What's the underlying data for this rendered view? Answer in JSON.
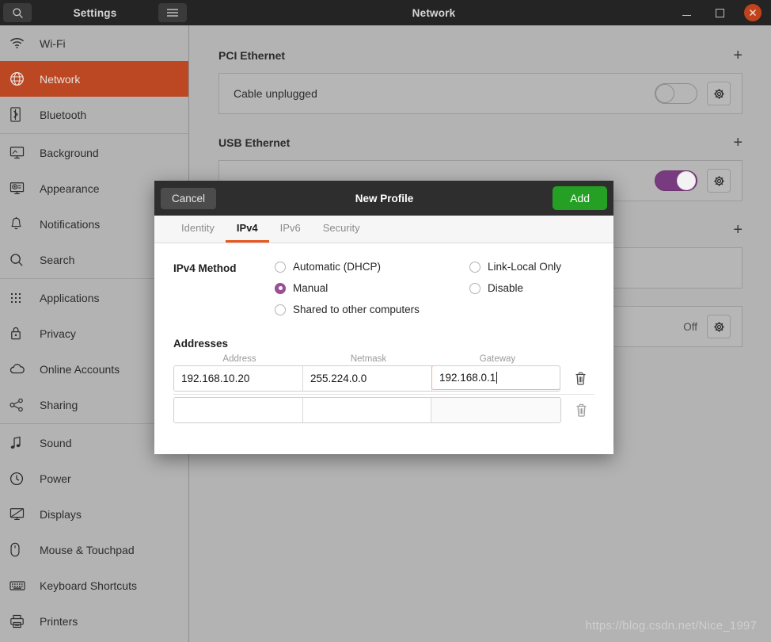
{
  "settings_window": {
    "titlebar": {
      "title": "Settings",
      "search_icon": "search-icon",
      "menu_icon": "hamburger-menu-icon"
    },
    "sidebar": {
      "groups": [
        {
          "items": [
            {
              "label": "Wi-Fi",
              "icon": "wifi-icon",
              "active": false
            },
            {
              "label": "Network",
              "icon": "globe-icon",
              "active": true
            },
            {
              "label": "Bluetooth",
              "icon": "bluetooth-icon",
              "active": false
            }
          ]
        },
        {
          "items": [
            {
              "label": "Background",
              "icon": "monitor-picture-icon",
              "active": false
            },
            {
              "label": "Appearance",
              "icon": "appearance-icon",
              "active": false
            },
            {
              "label": "Notifications",
              "icon": "bell-icon",
              "active": false
            },
            {
              "label": "Search",
              "icon": "magnifier-icon",
              "active": false
            }
          ]
        },
        {
          "items": [
            {
              "label": "Applications",
              "icon": "grid-dots-icon",
              "active": false
            },
            {
              "label": "Privacy",
              "icon": "lock-icon",
              "active": false
            },
            {
              "label": "Online Accounts",
              "icon": "cloud-icon",
              "active": false
            },
            {
              "label": "Sharing",
              "icon": "share-nodes-icon",
              "active": false
            }
          ]
        },
        {
          "items": [
            {
              "label": "Sound",
              "icon": "music-note-icon",
              "active": false
            },
            {
              "label": "Power",
              "icon": "power-icon",
              "active": false
            },
            {
              "label": "Displays",
              "icon": "display-icon",
              "active": false
            },
            {
              "label": "Mouse & Touchpad",
              "icon": "mouse-icon",
              "active": false
            },
            {
              "label": "Keyboard Shortcuts",
              "icon": "keyboard-icon",
              "active": false
            },
            {
              "label": "Printers",
              "icon": "printer-icon",
              "active": false
            }
          ]
        }
      ]
    }
  },
  "network_window": {
    "titlebar": {
      "title": "Network",
      "minimize": "minimize-icon",
      "maximize": "maximize-icon",
      "close": "close-icon"
    },
    "sections": [
      {
        "heading": "PCI Ethernet",
        "add_label": "+",
        "devices": [
          {
            "label": "Cable unplugged",
            "toggle_state": "off",
            "settings_icon": "gear-icon"
          }
        ]
      },
      {
        "heading": "USB Ethernet",
        "add_label": "+",
        "devices": [
          {
            "label": "",
            "toggle_state": "on",
            "settings_icon": "gear-icon"
          }
        ]
      },
      {
        "heading": "",
        "add_label": "+",
        "devices": [
          {
            "label": "",
            "toggle_state": "none",
            "settings_icon": ""
          }
        ]
      },
      {
        "heading": "",
        "add_label": "",
        "devices": [
          {
            "label": "",
            "status_text": "Off",
            "toggle_state": "none",
            "settings_icon": "gear-icon"
          }
        ]
      }
    ],
    "watermark": "https://blog.csdn.net/Nice_1997"
  },
  "dialog": {
    "header": {
      "cancel_label": "Cancel",
      "title": "New Profile",
      "add_label": "Add"
    },
    "tabs": [
      {
        "label": "Identity",
        "active": false
      },
      {
        "label": "IPv4",
        "active": true
      },
      {
        "label": "IPv6",
        "active": false
      },
      {
        "label": "Security",
        "active": false
      }
    ],
    "ipv4": {
      "method_label": "IPv4 Method",
      "methods_col1": [
        {
          "label": "Automatic (DHCP)",
          "selected": false
        },
        {
          "label": "Manual",
          "selected": true
        },
        {
          "label": "Shared to other computers",
          "selected": false
        }
      ],
      "methods_col2": [
        {
          "label": "Link-Local Only",
          "selected": false
        },
        {
          "label": "Disable",
          "selected": false
        }
      ],
      "addresses_title": "Addresses",
      "columns": [
        "Address",
        "Netmask",
        "Gateway"
      ],
      "rows": [
        {
          "address": "192.168.10.20",
          "netmask": "255.224.0.0",
          "gateway": "192.168.0.1",
          "focused_field": "gateway",
          "delete_icon": "trash-icon"
        },
        {
          "address": "",
          "netmask": "",
          "gateway": "",
          "focused_field": "",
          "delete_icon": "trash-icon"
        }
      ]
    }
  },
  "colors": {
    "accent_orange": "#e95420",
    "sidebar_active": "#bb4723",
    "add_green": "#25a025",
    "radio_purple": "#9b4f97",
    "toggle_on_purple": "#793b7f",
    "titlebar_dark": "#242424",
    "close_red": "#c0431c"
  }
}
